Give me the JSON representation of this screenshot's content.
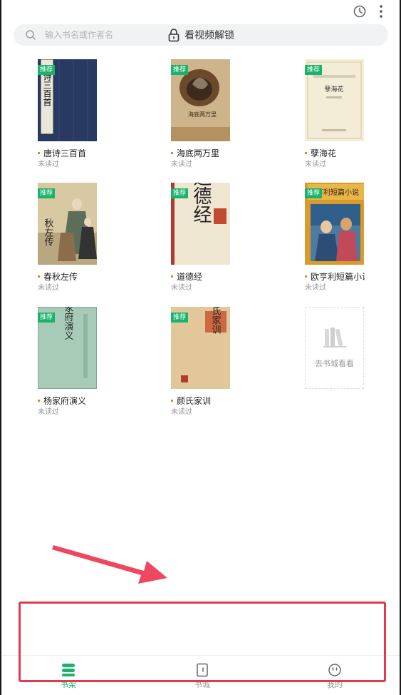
{
  "colors": {
    "accent": "#19b36b",
    "tag": "#19b36b",
    "dot": "#ff7e00",
    "annotation": "#e5384f"
  },
  "topbar": {
    "history_icon": "clock-icon",
    "more_icon": "more-vertical-icon"
  },
  "search": {
    "placeholder": "输入书名或作者名",
    "icon": "search-icon",
    "unlock_icon": "lock-icon",
    "unlock_label": "看视频解锁"
  },
  "books": [
    {
      "title": "唐诗三百首",
      "status": "未读过",
      "tag": "推荐"
    },
    {
      "title": "海底两万里",
      "status": "未读过",
      "tag": "推荐"
    },
    {
      "title": "孽海花",
      "status": "未读过",
      "tag": "推荐"
    },
    {
      "title": "春秋左传",
      "status": "未读过",
      "tag": "推荐"
    },
    {
      "title": "道德经",
      "status": "未读过",
      "tag": "推荐"
    },
    {
      "title": "欧亨利短篇小说",
      "status": "未读过",
      "tag": "推荐"
    },
    {
      "title": "杨家府演义",
      "status": "未读过",
      "tag": "推荐"
    },
    {
      "title": "颜氏家训",
      "status": "未读过",
      "tag": "推荐"
    }
  ],
  "cover_text": {
    "b0": "诗三百首",
    "b1": "海底两万里",
    "b2": "孽海花",
    "b3": "秋左传",
    "b4": "道德经",
    "b5": "亨利短篇小说",
    "b6": "杨家府演义",
    "b7": "颜氏家训"
  },
  "placeholder": {
    "icon": "bookshelf-icon",
    "label": "去书城看看"
  },
  "tabs": [
    {
      "label": "书架",
      "icon": "bookshelf-tab-icon",
      "active": true
    },
    {
      "label": "书城",
      "icon": "book-store-icon",
      "active": false
    },
    {
      "label": "我的",
      "icon": "profile-icon",
      "active": false
    }
  ]
}
